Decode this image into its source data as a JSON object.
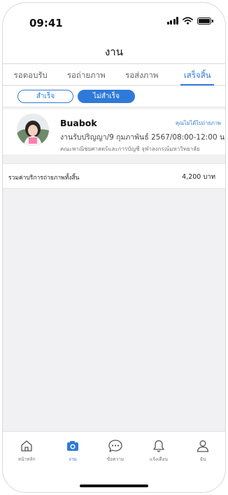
{
  "status_bar": {
    "time": "09:41"
  },
  "header": {
    "title": "งาน"
  },
  "tabs": [
    {
      "label": "รอตอบรับ",
      "active": false
    },
    {
      "label": "รอถ่ายภาพ",
      "active": false
    },
    {
      "label": "รอส่งภาพ",
      "active": false
    },
    {
      "label": "เสร็จสิ้น",
      "active": true
    }
  ],
  "filters": {
    "success_label": "สำเร็จ",
    "failed_label": "ไม่สำเร็จ",
    "selected": "failed"
  },
  "job": {
    "name": "Buabok",
    "note": "คุณไม่ได้ไปถ่ายภาพ",
    "description": "งานรับปริญญา/9 กุมภาพันธ์ 2567/08:00-12:00 น.",
    "faculty": "คณะพาณิชยศาสตร์และการบัญชี จุฬาลงกรณ์มหาวิทยาลัย"
  },
  "total": {
    "label": "รวมค่าบริการถ่ายภาพทั้งสิ้น",
    "amount": "4,200 บาท"
  },
  "bottom_nav": [
    {
      "label": "หน้าหลัก",
      "icon": "home-icon",
      "active": false
    },
    {
      "label": "งาน",
      "icon": "camera-icon",
      "active": true
    },
    {
      "label": "ข้อความ",
      "icon": "chat-icon",
      "active": false
    },
    {
      "label": "แจ้งเตือน",
      "icon": "bell-icon",
      "active": false
    },
    {
      "label": "ฉัน",
      "icon": "user-icon",
      "active": false
    }
  ],
  "colors": {
    "accent": "#2f7ad8",
    "background": "#f1f1f3"
  }
}
